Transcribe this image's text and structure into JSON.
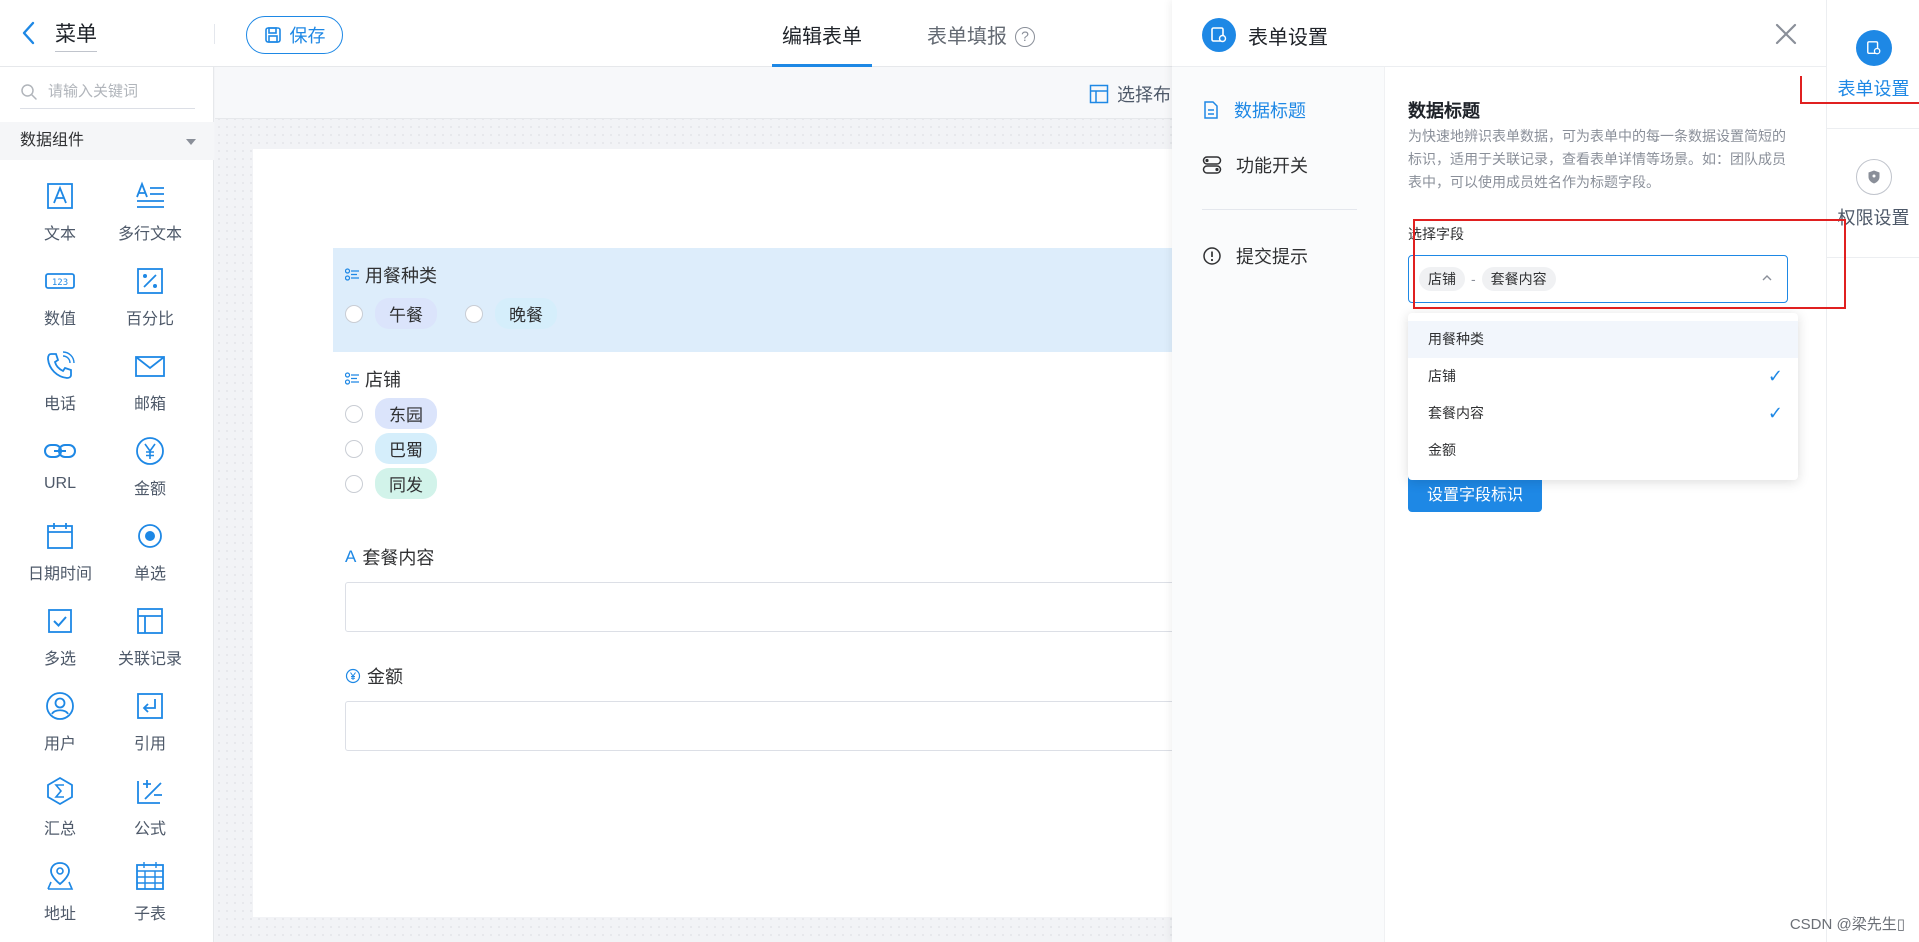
{
  "header": {
    "title": "菜单",
    "save_label": "保存",
    "tabs": [
      {
        "label": "编辑表单",
        "active": true
      },
      {
        "label": "表单填报",
        "active": false
      }
    ]
  },
  "left_panel": {
    "search_placeholder": "请输入关键词",
    "group_label": "数据组件",
    "components": [
      {
        "label": "文本",
        "icon": "text-a-icon"
      },
      {
        "label": "多行文本",
        "icon": "multiline-text-icon"
      },
      {
        "label": "数值",
        "icon": "number-icon"
      },
      {
        "label": "百分比",
        "icon": "percent-icon"
      },
      {
        "label": "电话",
        "icon": "phone-icon"
      },
      {
        "label": "邮箱",
        "icon": "mail-icon"
      },
      {
        "label": "URL",
        "icon": "link-icon"
      },
      {
        "label": "金额",
        "icon": "yen-icon"
      },
      {
        "label": "日期时间",
        "icon": "calendar-icon"
      },
      {
        "label": "单选",
        "icon": "radio-icon"
      },
      {
        "label": "多选",
        "icon": "checkbox-icon"
      },
      {
        "label": "关联记录",
        "icon": "related-record-icon"
      },
      {
        "label": "用户",
        "icon": "user-icon"
      },
      {
        "label": "引用",
        "icon": "reference-icon"
      },
      {
        "label": "汇总",
        "icon": "sum-icon"
      },
      {
        "label": "公式",
        "icon": "formula-icon"
      },
      {
        "label": "地址",
        "icon": "location-icon"
      },
      {
        "label": "子表",
        "icon": "subtable-icon"
      }
    ]
  },
  "canvas": {
    "layout_label": "选择布",
    "fields": {
      "meal_type": {
        "title": "用餐种类",
        "options": [
          "午餐",
          "晚餐"
        ]
      },
      "shop": {
        "title": "店铺",
        "options": [
          "东园",
          "巴蜀",
          "同发"
        ]
      },
      "meal_content": {
        "title": "套餐内容"
      },
      "amount": {
        "title": "金额"
      }
    }
  },
  "drawer": {
    "title": "表单设置",
    "nav": [
      {
        "label": "数据标题",
        "active": true
      },
      {
        "label": "功能开关",
        "active": false
      },
      {
        "label": "提交提示",
        "active": false
      }
    ],
    "section_title": "数据标题",
    "section_desc": "为快速地辨识表单数据，可为表单中的每一条数据设置简短的标识，适用于关联记录，查看表单详情等场景。如：团队成员表中，可以使用成员姓名作为标题字段。",
    "field_label": "选择字段",
    "selected_tags": [
      "店铺",
      "套餐内容"
    ],
    "tag_separator": "-",
    "dropdown_options": [
      {
        "label": "用餐种类",
        "checked": false
      },
      {
        "label": "店铺",
        "checked": true
      },
      {
        "label": "套餐内容",
        "checked": true
      },
      {
        "label": "金额",
        "checked": false
      }
    ],
    "check_mark": "✓",
    "button_label": "设置字段标识"
  },
  "rail": {
    "items": [
      {
        "label": "表单设置",
        "active": true
      },
      {
        "label": "权限设置",
        "active": false
      }
    ]
  },
  "watermark": "CSDN @梁先生▯",
  "colors": {
    "accent": "#1e88e5",
    "selected_field_bg": "#ddedfb",
    "pill_blue": "#dbe4fb",
    "pill_cyan": "#d5eefb",
    "pill_green": "#d2f3ea",
    "annotation": "#e02020"
  }
}
